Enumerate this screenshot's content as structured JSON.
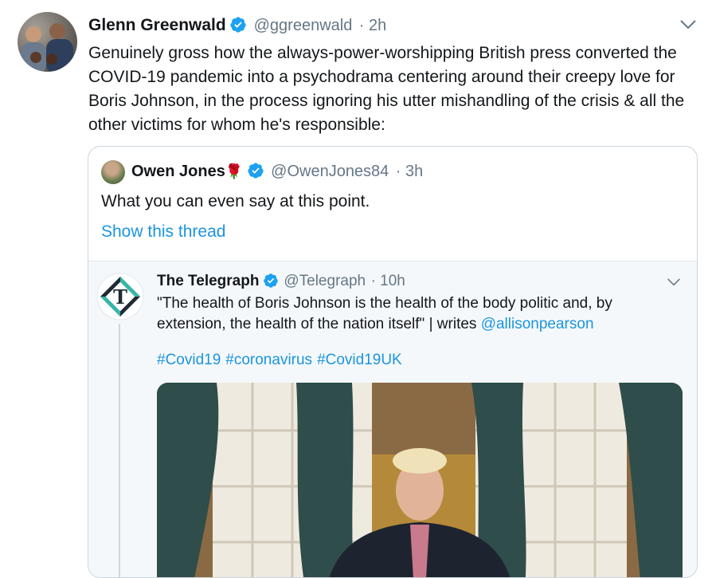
{
  "tweet": {
    "author_name": "Glenn Greenwald",
    "handle": "@ggreenwald",
    "time": "· 2h",
    "text": "Genuinely gross how the always-power-worshipping British press converted the COVID-19 pandemic into a psychodrama centering around their creepy love for Boris Johnson, in the process ignoring his utter mishandling of the crisis & all the other victims for whom he's responsible:"
  },
  "quoted": {
    "author_name": "Owen Jones",
    "emoji": "🌹",
    "handle": "@OwenJones84",
    "time": "· 3h",
    "text": "What you can even say at this point.",
    "show_thread": "Show this thread"
  },
  "embedded": {
    "author_name": "The Telegraph",
    "handle": "@Telegraph",
    "time": "· 10h",
    "text": "\"The health of Boris Johnson is the health of the body politic and, by extension, the health of the nation itself\" | writes ",
    "mention": "@allisonpearson",
    "hashtags": [
      "#Covid19",
      "#coronavirus",
      "#Covid19UK"
    ],
    "logo_letter": "T"
  },
  "colors": {
    "accent": "#1b95e0",
    "verified": "#1da1f2",
    "secondary_text": "#657786",
    "border": "#ccd6dd"
  },
  "icons": [
    "verified-badge-icon",
    "chevron-down-icon",
    "rose-emoji-icon"
  ]
}
